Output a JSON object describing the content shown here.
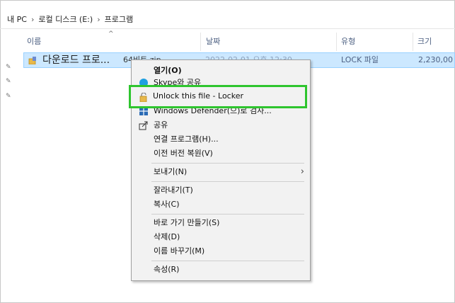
{
  "breadcrumb": [
    "내 PC",
    "로컬 디스크 (E:)",
    "프로그램"
  ],
  "breadcrumb_sep": "›",
  "columns": {
    "name": "이름",
    "date": "날짜",
    "type": "유형",
    "size": "크기"
  },
  "row": {
    "name": "다운로드 프로...",
    "name_suffix": "64비트.zip",
    "date": "2022-02-01 오후 12:30",
    "type": "LOCK 파일",
    "size": "2,230,00"
  },
  "menu": {
    "open": "열기(O)",
    "skype": "Skype와 공유",
    "unlock": "Unlock this file - Locker",
    "defender": "Windows Defender(으)로 검사...",
    "share": "공유",
    "open_with": "연결 프로그램(H)...",
    "restore": "이전 버전 복원(V)",
    "send_to": "보내기(N)",
    "cut": "잘라내기(T)",
    "copy": "복사(C)",
    "shortcut": "바로 가기 만들기(S)",
    "delete": "삭제(D)",
    "rename": "이름 바꾸기(M)",
    "properties": "속성(R)"
  },
  "colors": {
    "highlight_border": "#2ec52e",
    "selection": "#cce8ff"
  }
}
